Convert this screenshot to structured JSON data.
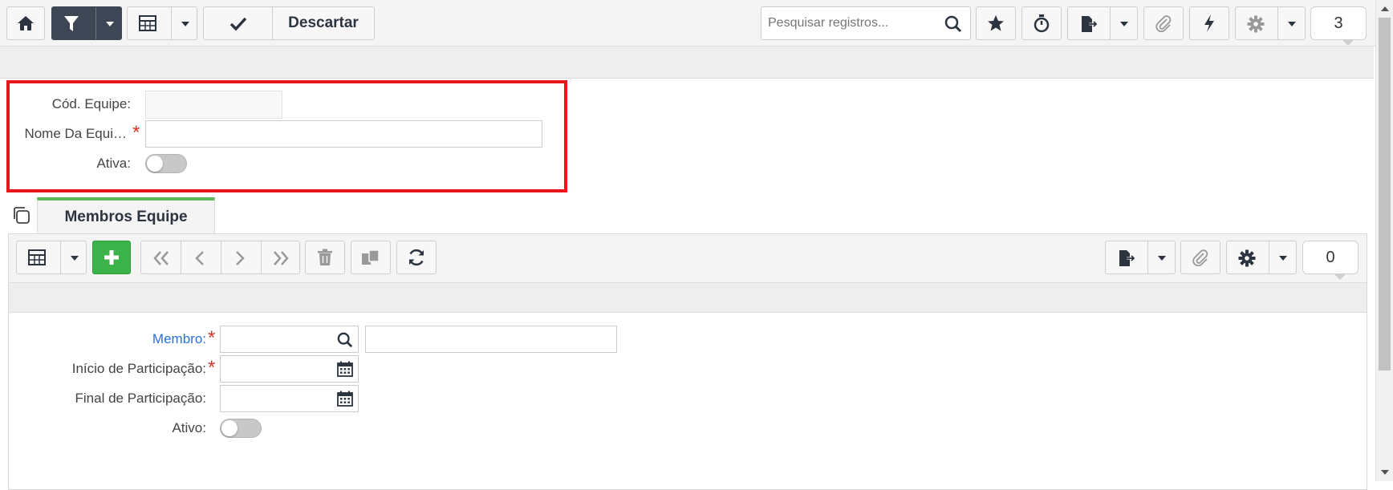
{
  "toolbar": {
    "discard_label": "Descartar",
    "search_placeholder": "Pesquisar registros...",
    "record_count": "3"
  },
  "team_form": {
    "code_label": "Cód. Equipe:",
    "name_label": "Nome Da Equi…",
    "active_label": "Ativa:",
    "required_mark": "*"
  },
  "tabs": [
    {
      "label": "Membros Equipe",
      "active": true
    }
  ],
  "members_toolbar": {
    "record_count": "0"
  },
  "member_form": {
    "member_label": "Membro:",
    "start_label": "Início de Participação:",
    "end_label": "Final de Participação:",
    "active_label": "Ativo:",
    "required_mark": "*"
  },
  "colors": {
    "highlight_border": "#e8161b",
    "tab_accent": "#5cb85c",
    "link_label": "#2a6fdb",
    "dark_button": "#3d4654",
    "add_button": "#3cb34a"
  }
}
